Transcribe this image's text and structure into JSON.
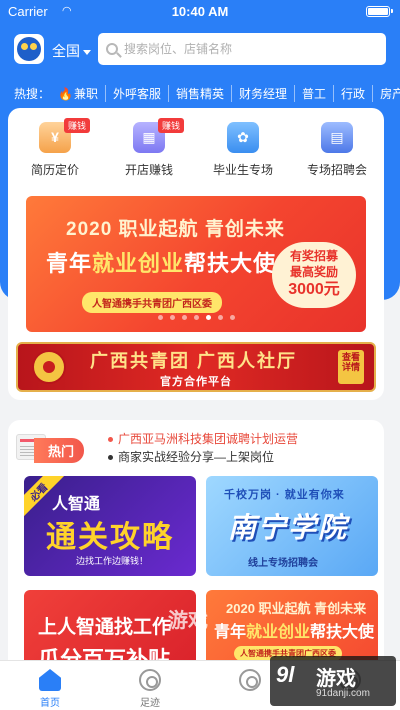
{
  "status": {
    "carrier": "Carrier",
    "time": "10:40 AM"
  },
  "header": {
    "city": "全国",
    "search_placeholder": "搜索岗位、店铺名称"
  },
  "hot_search": {
    "label": "热搜：",
    "keywords": [
      "兼职",
      "外呼客服",
      "销售精英",
      "财务经理",
      "普工",
      "行政",
      "房产"
    ]
  },
  "tiles": [
    {
      "label": "简历定价",
      "badge": "赚钱",
      "glyph": "¥"
    },
    {
      "label": "开店赚钱",
      "badge": "赚钱",
      "glyph": "▦"
    },
    {
      "label": "毕业生专场",
      "badge": "",
      "glyph": "✿"
    },
    {
      "label": "专场招聘会",
      "badge": "",
      "glyph": "▤"
    }
  ],
  "banner": {
    "line1": "2020 职业起航 青创未来",
    "line2_a": "青年",
    "line2_b": "就业创业",
    "line2_c": "帮扶大使",
    "sub": "人智通携手共青团广西区委",
    "bubble_a": "有奖招募",
    "bubble_b": "最高奖励",
    "bubble_c": "3000元",
    "slide_count": 7,
    "active_slide": 4
  },
  "partner": {
    "title": "广西共青团 广西人社厅",
    "subtitle": "官方合作平台",
    "stamp": "查看详情"
  },
  "hot": {
    "tag": "热门",
    "items": [
      "广西亚马洲科技集团诚聘计划运营",
      "商家实战经验分享—上架岗位"
    ]
  },
  "promos": {
    "p1": {
      "ribbon": "必看",
      "a": "人智通",
      "b": "通关攻略",
      "c": "边找工作边赚钱！"
    },
    "p2": {
      "a": "千校万岗 · 就业有你来",
      "b": "南宁学院",
      "c": "线上专场招聘会"
    },
    "p3": {
      "a": "上人智通找工作",
      "b": "瓜分百万补贴"
    },
    "p4": {
      "a": "2020 职业起航 青创未来",
      "b1": "青年",
      "b2": "就业创业",
      "b3": "帮扶大使",
      "c": "人智通携手共青团广西区委"
    }
  },
  "tabbar": [
    {
      "label": "首页",
      "icon": "home-icon",
      "active": true
    },
    {
      "label": "足迹",
      "icon": "footprint-icon",
      "active": false
    },
    {
      "label": "",
      "icon": "message-icon",
      "active": false
    },
    {
      "label": "",
      "icon": "profile-icon",
      "active": false
    }
  ],
  "watermark": {
    "logo": "9l",
    "text": "游戏",
    "url": "91danji.com",
    "overlay": "游戏"
  },
  "colors": {
    "primary": "#2a7ff7",
    "accent_red": "#e8322b",
    "badge_red": "#f23b3b"
  }
}
